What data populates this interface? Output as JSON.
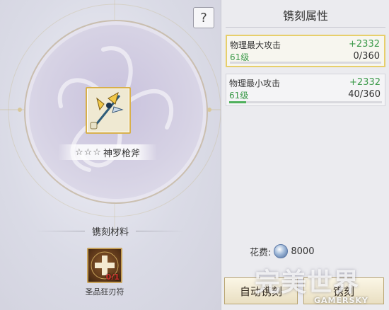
{
  "help": {
    "label": "?"
  },
  "weapon": {
    "stars": "☆☆☆",
    "name": "神罗枪斧"
  },
  "materials": {
    "title": "镌刻材料",
    "item": {
      "name": "圣品狂刃符",
      "count": "0/1"
    }
  },
  "panel": {
    "title": "镌刻属性",
    "attributes": [
      {
        "name": "物理最大攻击",
        "bonus": "+2332",
        "level": "61级",
        "progress": "0/360",
        "fraction": 0.0,
        "selected": true
      },
      {
        "name": "物理最小攻击",
        "bonus": "+2332",
        "level": "61级",
        "progress": "40/360",
        "fraction": 0.111,
        "selected": false
      }
    ],
    "cost": {
      "label": "花费:",
      "amount": "8000"
    },
    "buttons": {
      "auto": "自动镌刻",
      "engrave": "镌刻"
    }
  },
  "watermark": {
    "logo": "完美世界",
    "site": "GAMERSKY"
  },
  "colors": {
    "accent_gold": "#e7cf6b",
    "positive_green": "#3c9a4a",
    "count_red": "#d0312d"
  }
}
